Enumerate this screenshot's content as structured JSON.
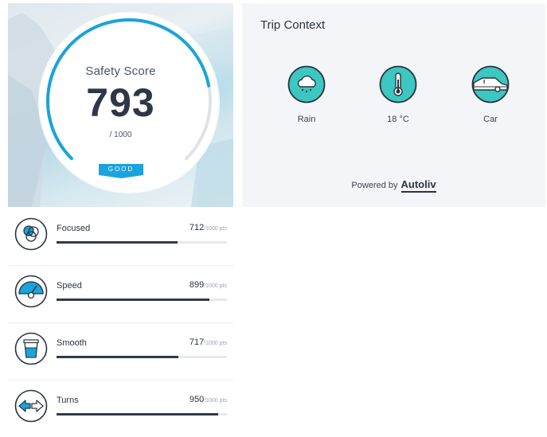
{
  "score": {
    "label": "Safety Score",
    "value": "793",
    "max_text": "/ 1000",
    "badge": "GOOD",
    "fraction": 0.793
  },
  "trip": {
    "title": "Trip Context",
    "items": [
      {
        "label": "Rain",
        "icon": "rain-cloud-icon"
      },
      {
        "label": "18 °C",
        "icon": "thermometer-icon"
      },
      {
        "label": "Car",
        "icon": "car-icon"
      }
    ],
    "powered_by": "Powered by",
    "brand": "Autoliv"
  },
  "metrics": [
    {
      "name": "Focused",
      "value": "712",
      "unit": "/1000 pts",
      "fraction": 0.712,
      "icon": "focus-circles-icon"
    },
    {
      "name": "Speed",
      "value": "899",
      "unit": "/1000 pts",
      "fraction": 0.899,
      "icon": "speedometer-icon"
    },
    {
      "name": "Smooth",
      "value": "717",
      "unit": "/1000 pts",
      "fraction": 0.717,
      "icon": "cup-icon"
    },
    {
      "name": "Turns",
      "value": "950",
      "unit": "/1000 pts",
      "fraction": 0.95,
      "icon": "turn-arrows-icon"
    }
  ],
  "colors": {
    "accent": "#1aa3dc",
    "icon_fill": "#3cc7c0",
    "bar": "#2f3a4d",
    "text": "#2b3440"
  }
}
